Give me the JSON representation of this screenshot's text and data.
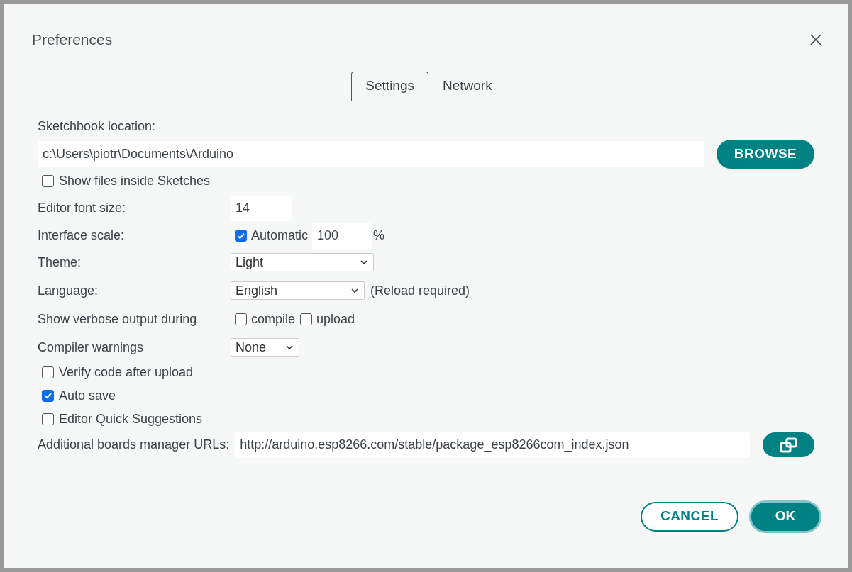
{
  "dialog": {
    "title": "Preferences"
  },
  "tabs": [
    {
      "label": "Settings",
      "selected": true
    },
    {
      "label": "Network",
      "selected": false
    }
  ],
  "sketchbook": {
    "label": "Sketchbook location:",
    "value": "c:\\Users\\piotr\\Documents\\Arduino",
    "button": "BROWSE"
  },
  "show_files": {
    "label": "Show files inside Sketches",
    "checked": false
  },
  "editor_font_size": {
    "label": "Editor font size:",
    "value": "14"
  },
  "interface_scale": {
    "label": "Interface scale:",
    "automatic": {
      "label": "Automatic",
      "checked": true
    },
    "value": "100",
    "unit": "%"
  },
  "theme": {
    "label": "Theme:",
    "value": "Light"
  },
  "language": {
    "label": "Language:",
    "value": "English",
    "note": "(Reload required)"
  },
  "verbose": {
    "label": "Show verbose output during",
    "options": [
      {
        "label": "compile",
        "checked": false
      },
      {
        "label": "upload",
        "checked": false
      }
    ]
  },
  "compiler_warnings": {
    "label": "Compiler warnings",
    "value": "None"
  },
  "options": [
    {
      "label": "Verify code after upload",
      "checked": false
    },
    {
      "label": "Auto save",
      "checked": true
    },
    {
      "label": "Editor Quick Suggestions",
      "checked": false
    }
  ],
  "boards_urls": {
    "label": "Additional boards manager URLs:",
    "value": "http://arduino.esp8266.com/stable/package_esp8266com_index.json"
  },
  "buttons": {
    "cancel": "CANCEL",
    "ok": "OK"
  }
}
